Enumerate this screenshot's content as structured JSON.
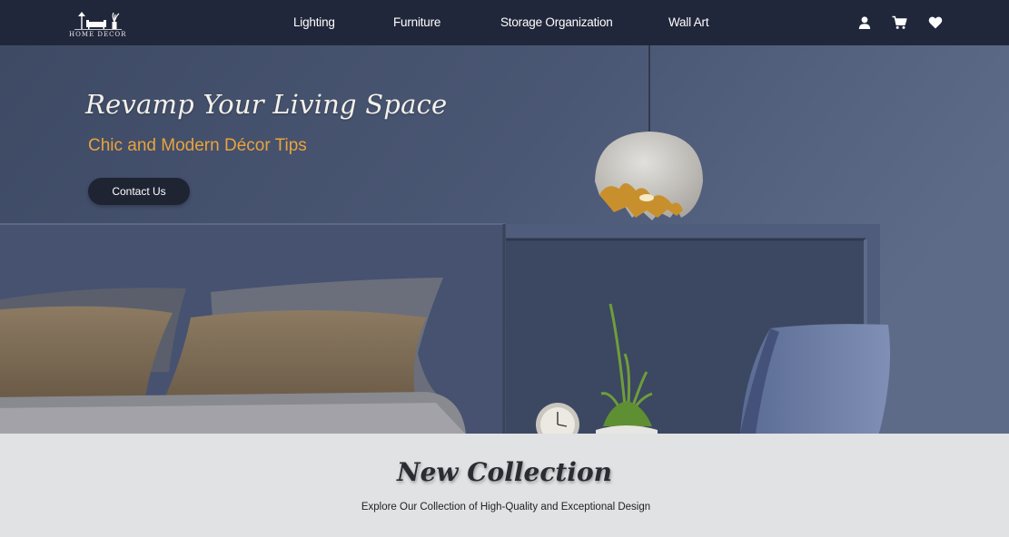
{
  "brand": {
    "logo_text": "HOME DECOR"
  },
  "nav": {
    "links": [
      "Lighting",
      "Furniture",
      "Storage Organization",
      "Wall Art"
    ],
    "icons": [
      "user-icon",
      "cart-icon",
      "heart-icon"
    ]
  },
  "hero": {
    "title": "Revamp Your Living Space",
    "subtitle": "Chic and Modern Décor Tips",
    "cta_label": "Contact Us"
  },
  "collection": {
    "title": "New Collection",
    "subtitle": "Explore Our Collection of High-Quality and Exceptional Design"
  },
  "colors": {
    "navbar": "#21273a",
    "accent": "#e9a33d",
    "hero_wall": "#46536f",
    "section_bg": "#e1e2e4"
  }
}
